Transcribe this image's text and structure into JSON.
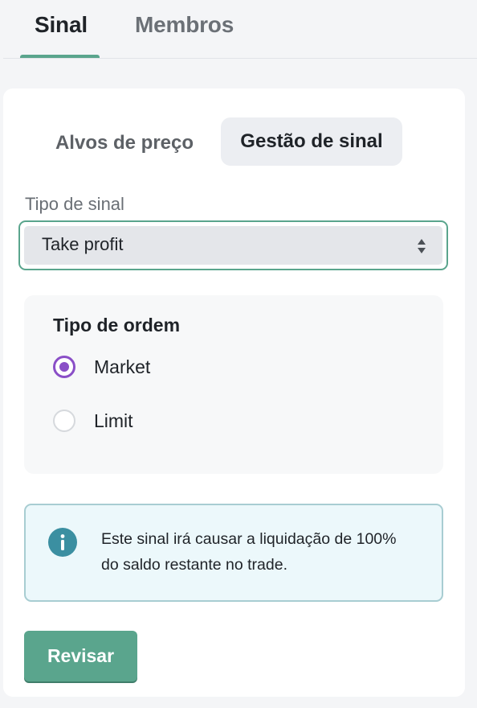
{
  "tabs": {
    "items": [
      {
        "label": "Sinal",
        "active": true
      },
      {
        "label": "Membros",
        "active": false
      }
    ],
    "accent_color": "#5aa58d"
  },
  "segment": {
    "options": [
      {
        "label": "Alvos de preço",
        "selected": false
      },
      {
        "label": "Gestão de sinal",
        "selected": true
      }
    ]
  },
  "signal_type": {
    "label": "Tipo de sinal",
    "value": "Take profit",
    "icon": "sort-arrows-icon"
  },
  "order_type": {
    "title": "Tipo de ordem",
    "options": [
      {
        "label": "Market",
        "checked": true
      },
      {
        "label": "Limit",
        "checked": false
      }
    ],
    "radio_color": "#8a4fc7"
  },
  "info": {
    "icon": "info-icon",
    "text": "Este sinal irá causar a liquidação de 100% do saldo restante no trade.",
    "icon_color": "#3b8fa1"
  },
  "actions": {
    "review_label": "Revisar"
  }
}
